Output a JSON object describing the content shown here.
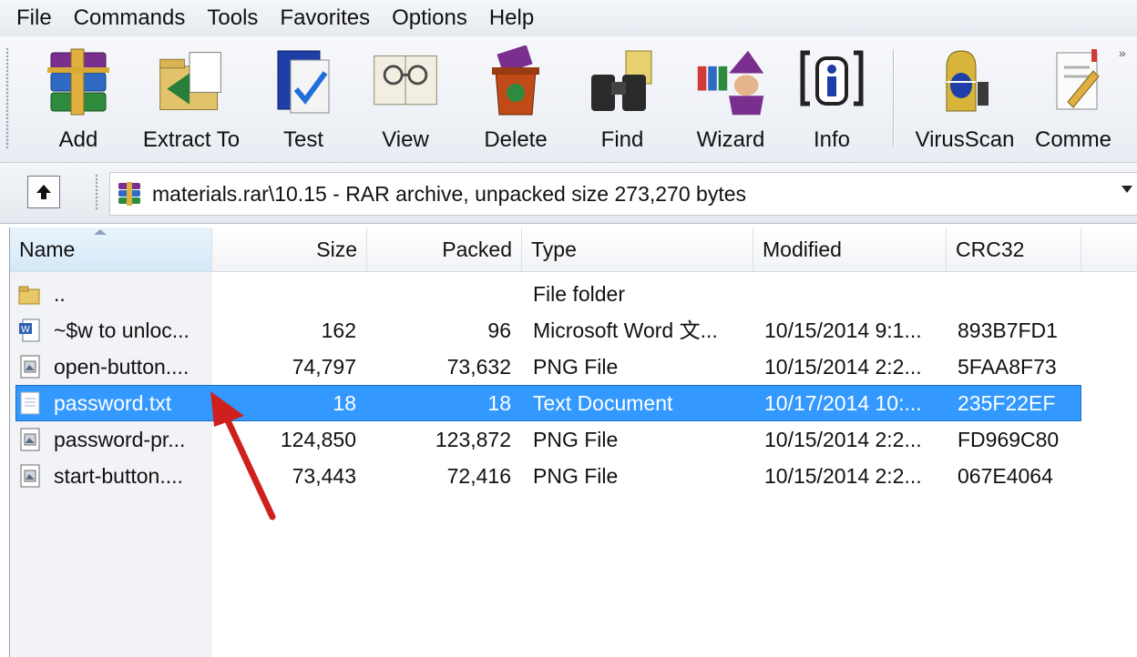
{
  "menu": [
    "File",
    "Commands",
    "Tools",
    "Favorites",
    "Options",
    "Help"
  ],
  "toolbar": {
    "buttons": [
      {
        "label": "Add",
        "icon": "add-archive-icon"
      },
      {
        "label": "Extract To",
        "icon": "extract-folder-icon"
      },
      {
        "label": "Test",
        "icon": "test-check-icon"
      },
      {
        "label": "View",
        "icon": "view-glasses-icon"
      },
      {
        "label": "Delete",
        "icon": "recycle-bin-icon"
      },
      {
        "label": "Find",
        "icon": "binoculars-icon"
      },
      {
        "label": "Wizard",
        "icon": "wizard-icon"
      },
      {
        "label": "Info",
        "icon": "info-icon"
      },
      {
        "label": "VirusScan",
        "icon": "virus-scan-icon"
      },
      {
        "label": "Comme",
        "icon": "comment-icon"
      }
    ],
    "more": "»"
  },
  "address": {
    "path": "materials.rar\\10.15 - RAR archive, unpacked size 273,270 bytes"
  },
  "columns": [
    "Name",
    "Size",
    "Packed",
    "Type",
    "Modified",
    "CRC32"
  ],
  "rows": [
    {
      "name": "..",
      "size": "",
      "packed": "",
      "type": "File folder",
      "modified": "",
      "crc": "",
      "icon": "folder-icon",
      "selected": false
    },
    {
      "name": "~$w to unloc...",
      "size": "162",
      "packed": "96",
      "type": "Microsoft Word 文...",
      "modified": "10/15/2014 9:1...",
      "crc": "893B7FD1",
      "icon": "word-doc-icon",
      "selected": false
    },
    {
      "name": "open-button....",
      "size": "74,797",
      "packed": "73,632",
      "type": "PNG File",
      "modified": "10/15/2014 2:2...",
      "crc": "5FAA8F73",
      "icon": "image-file-icon",
      "selected": false
    },
    {
      "name": "password.txt",
      "size": "18",
      "packed": "18",
      "type": "Text Document",
      "modified": "10/17/2014 10:...",
      "crc": "235F22EF",
      "icon": "text-file-icon",
      "selected": true
    },
    {
      "name": "password-pr...",
      "size": "124,850",
      "packed": "123,872",
      "type": "PNG File",
      "modified": "10/15/2014 2:2...",
      "crc": "FD969C80",
      "icon": "image-file-icon",
      "selected": false
    },
    {
      "name": "start-button....",
      "size": "73,443",
      "packed": "72,416",
      "type": "PNG File",
      "modified": "10/15/2014 2:2...",
      "crc": "067E4064",
      "icon": "image-file-icon",
      "selected": false
    }
  ],
  "colors": {
    "selection": "#3399ff",
    "arrow": "#d0201e"
  }
}
